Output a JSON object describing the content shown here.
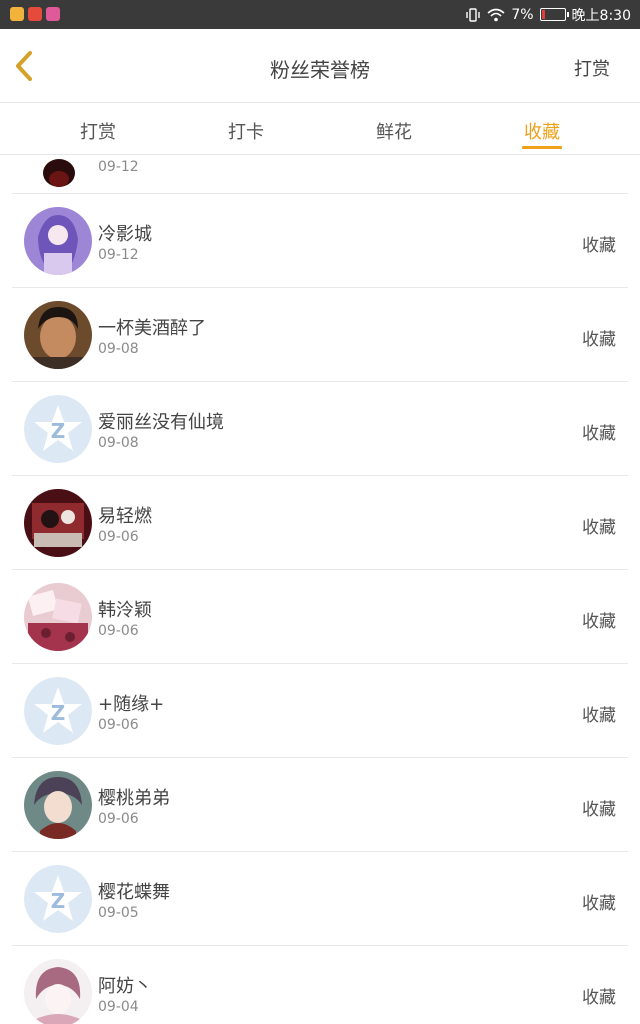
{
  "status_bar": {
    "battery_percent": "7%",
    "time": "晚上8:30",
    "app_icons": [
      "app-icon-1",
      "app-icon-2",
      "app-icon-3"
    ]
  },
  "nav": {
    "title": "粉丝荣誉榜",
    "action_label": "打赏"
  },
  "tabs": [
    {
      "label": "打赏",
      "active": false
    },
    {
      "label": "打卡",
      "active": false
    },
    {
      "label": "鲜花",
      "active": false
    },
    {
      "label": "收藏",
      "active": true
    }
  ],
  "colors": {
    "accent": "#f0a11b",
    "default_avatar": "#dde8f5"
  },
  "items": [
    {
      "name": "",
      "date": "09-12",
      "action": "",
      "avatar": "photo-dark"
    },
    {
      "name": "冷影城",
      "date": "09-12",
      "action": "收藏",
      "avatar": "anime-purple"
    },
    {
      "name": "一杯美酒醉了",
      "date": "09-08",
      "action": "收藏",
      "avatar": "photo-man"
    },
    {
      "name": "爱丽丝没有仙境",
      "date": "09-08",
      "action": "收藏",
      "avatar": "default-qq"
    },
    {
      "name": "易轻燃",
      "date": "09-06",
      "action": "收藏",
      "avatar": "anime-dark-red"
    },
    {
      "name": "韩泠颖",
      "date": "09-06",
      "action": "收藏",
      "avatar": "anime-pink-cards"
    },
    {
      "name": "+随缘+",
      "date": "09-06",
      "action": "收藏",
      "avatar": "default-qq"
    },
    {
      "name": "樱桃弟弟",
      "date": "09-06",
      "action": "收藏",
      "avatar": "anime-boy"
    },
    {
      "name": "樱花蝶舞",
      "date": "09-05",
      "action": "收藏",
      "avatar": "default-qq"
    },
    {
      "name": "阿妨丶",
      "date": "09-04",
      "action": "收藏",
      "avatar": "anime-girl-sketch"
    }
  ]
}
